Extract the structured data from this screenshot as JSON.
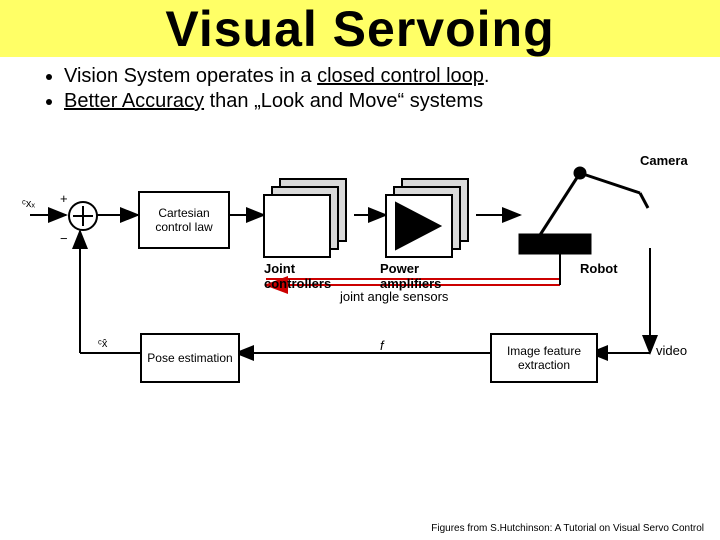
{
  "title": "Visual Servoing",
  "bullets": {
    "b1_pre": "Vision System operates in a ",
    "b1_u": "closed control loop",
    "b1_post": ".",
    "b2_u": "Better Accuracy",
    "b2_post": " than „Look and Move“ systems"
  },
  "diagram": {
    "input_sym": "ᶜxₓ",
    "plus": "+",
    "minus": "−",
    "cartesian": "Cartesian control law",
    "joint_ctrl": "Joint controllers",
    "power_amp": "Power amplifiers",
    "robot": "Robot",
    "camera": "Camera",
    "joint_sensors": "joint angle sensors",
    "pose_est": "Pose estimation",
    "feat_ext": "Image feature extraction",
    "feedback_sym": "ᶜx̂",
    "f_sym": "f",
    "video": "video"
  },
  "citation": "Figures from S.Hutchinson: A Tutorial on Visual Servo Control"
}
